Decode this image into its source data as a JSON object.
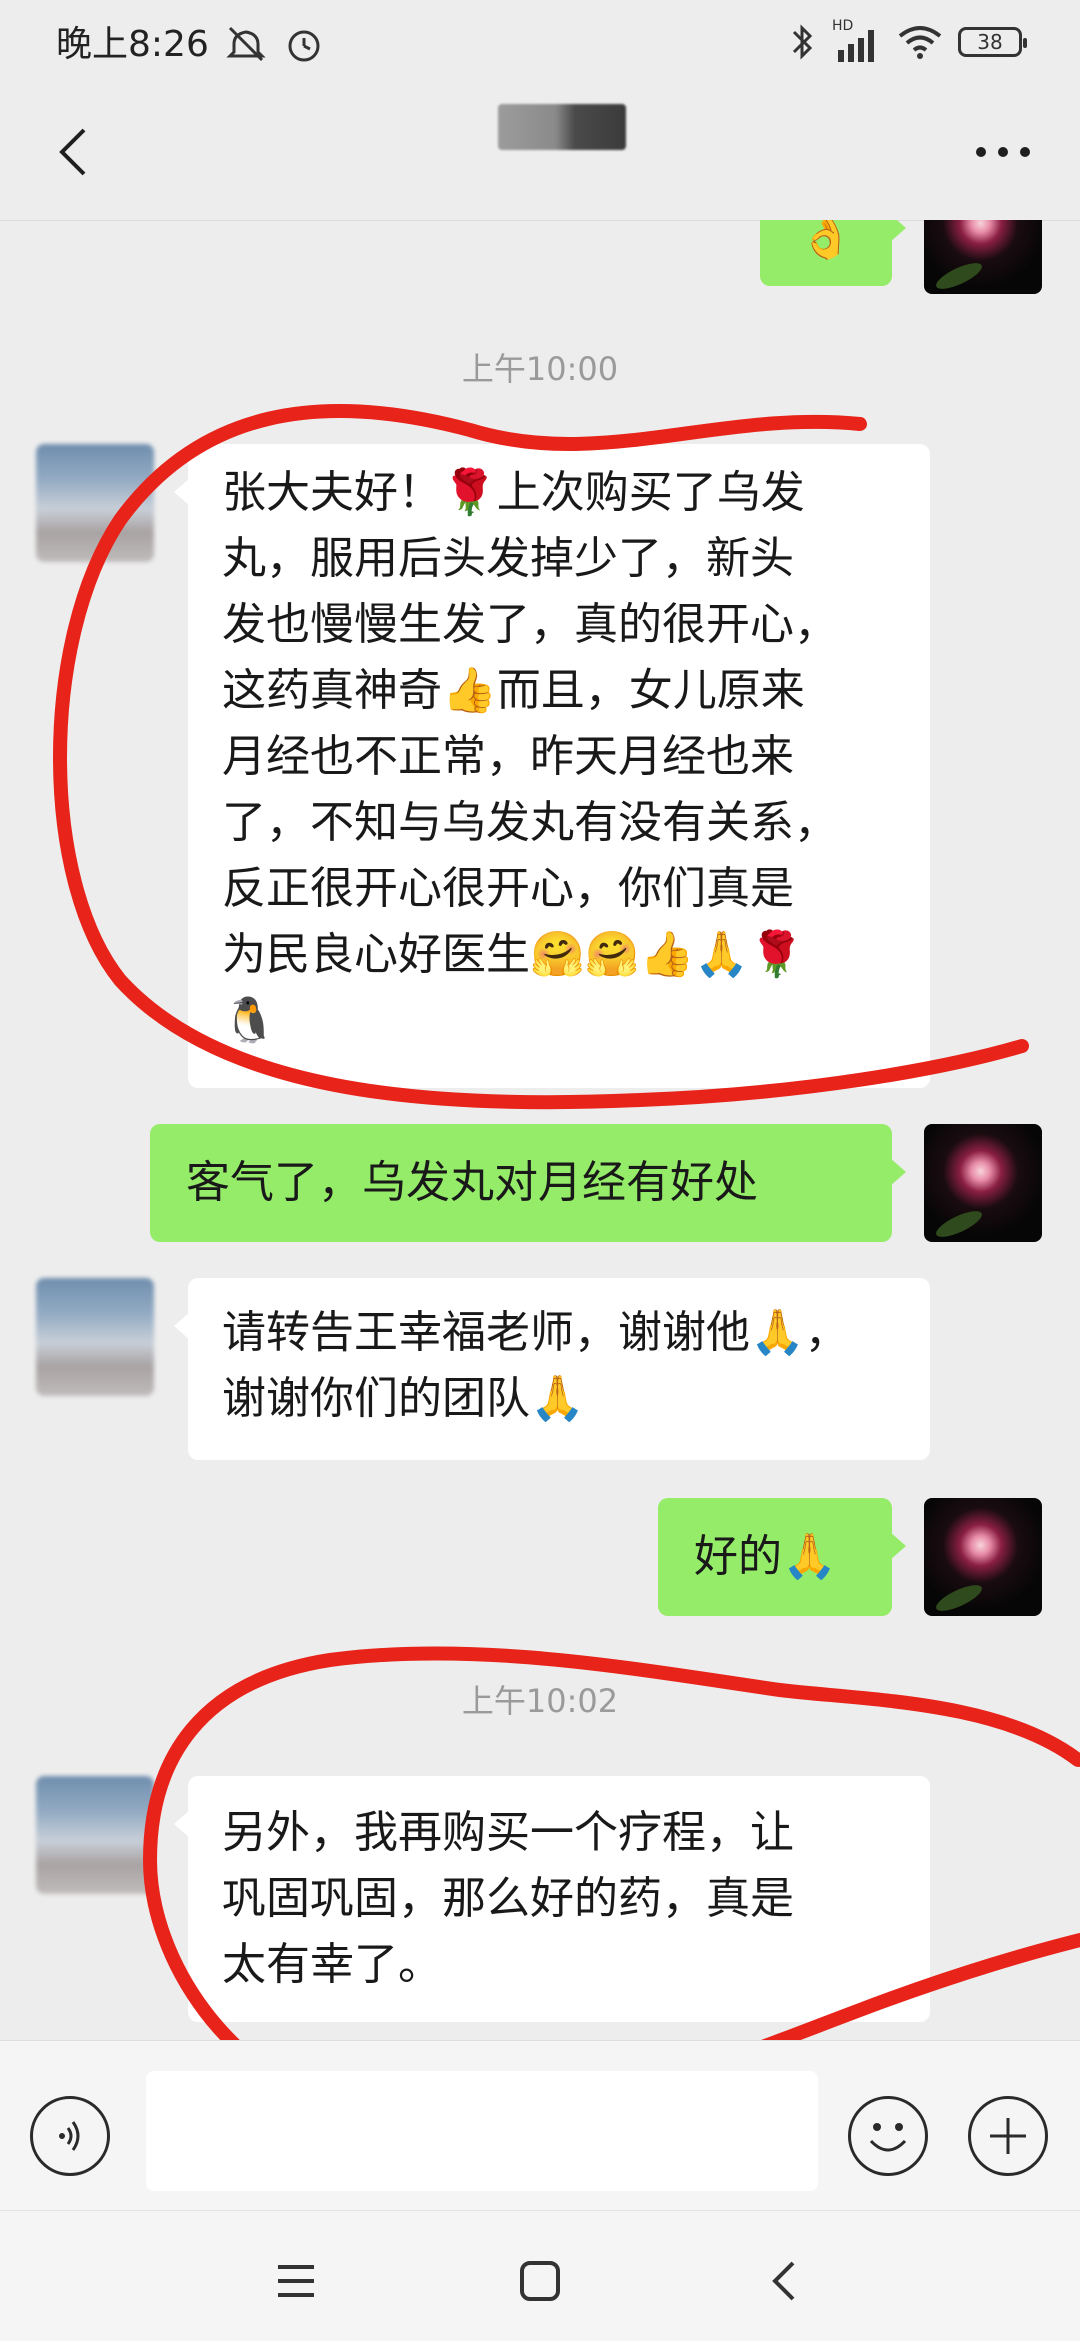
{
  "status_bar": {
    "time": "晚上8:26",
    "network": "HD",
    "battery": "38"
  },
  "header": {
    "back_icon": "chevron-left-icon",
    "more_icon": "more-dots-icon"
  },
  "chat": {
    "timestamps": [
      "上午10:00",
      "上午10:02"
    ],
    "messages": [
      {
        "side": "left",
        "lines": [
          "张大夫好！🌹上次购买了乌发",
          "丸，服用后头发掉少了，新头",
          "发也慢慢生发了，真的很开心，",
          "这药真神奇👍而且，女儿原来",
          "月经也不正常，昨天月经也来",
          "了，不知与乌发丸有没有关系，",
          "反正很开心很开心，你们真是",
          "为民良心好医生🤗🤗👍🙏🌹",
          "🐧"
        ]
      },
      {
        "side": "right",
        "text": "客气了，乌发丸对月经有好处"
      },
      {
        "side": "left",
        "lines": [
          "请转告王幸福老师，谢谢他🙏，",
          "谢谢你们的团队🙏"
        ]
      },
      {
        "side": "right",
        "text": "好的🙏"
      },
      {
        "side": "left",
        "lines": [
          "另外，我再购买一个疗程，让",
          "巩固巩固，那么好的药，真是",
          "太有幸了。"
        ]
      }
    ],
    "top_partial_emoji": "👌"
  },
  "input_bar": {
    "voice_icon": "voice-icon",
    "emoji_icon": "smiley-icon",
    "plus_icon": "plus-icon"
  },
  "nav_bar": {
    "menu_icon": "menu-icon",
    "home_icon": "home-icon",
    "back_icon": "back-icon"
  },
  "colors": {
    "background": "#ededed",
    "green_bubble": "#95ec69",
    "white_bubble": "#ffffff",
    "annotation_red": "#e8231a"
  }
}
